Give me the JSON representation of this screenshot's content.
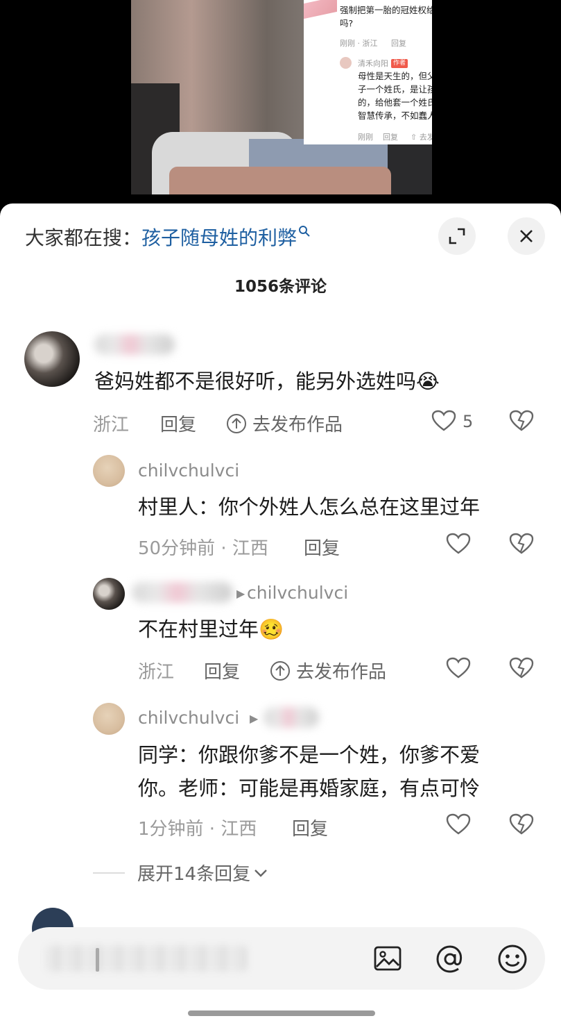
{
  "video": {
    "question": "强制把第一胎的冠姓权给女方，能提高生育率吗?",
    "question_meta": "刚刚 · 浙江",
    "question_reply": "回复",
    "reply_user": "清禾向阳",
    "author_badge": "作者",
    "reply_text": "母性是天生的，但父性不是。说白了给孩子一个姓氏，是让孩子爹认为孩子是自己的，给他套一个姓氏枷锁。祖先几千年的智慧传承，不如蠢人灵机一动。",
    "reply_meta": "刚刚",
    "reply_reply": "回复",
    "reply_post": "去发布作品"
  },
  "header": {
    "search_prefix": "大家都在搜：",
    "search_term": "孩子随母姓的利弊",
    "comment_count": "1056条评论"
  },
  "comments": [
    {
      "text": "爸妈姓都不是很好听，能另外选姓吗😭",
      "location": "浙江",
      "reply": "回复",
      "post": "去发布作品",
      "likes": "5"
    },
    {
      "user": "chilvchulvci",
      "text": "村里人：你个外姓人怎么总在这里过年",
      "meta": "50分钟前 · 江西",
      "reply": "回复"
    },
    {
      "reply_to": "chilvchulvci",
      "text": "不在村里过年🥴",
      "location": "浙江",
      "reply": "回复",
      "post": "去发布作品"
    },
    {
      "user": "chilvchulvci",
      "line1": "同学：你跟你爹不是一个姓，你爹不爱",
      "line2": "你。老师：可能是再婚家庭，有点可怜",
      "meta": "1分钟前 · 江西",
      "reply": "回复"
    }
  ],
  "expand_replies": "展开14条回复"
}
